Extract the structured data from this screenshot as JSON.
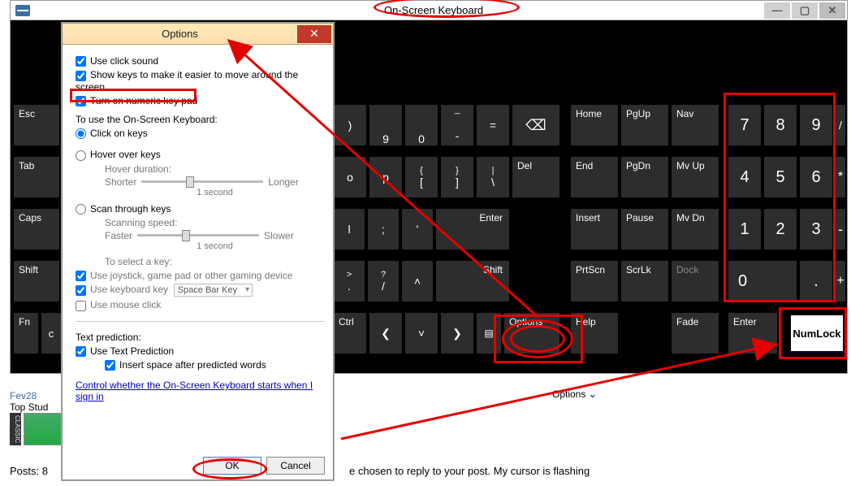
{
  "osk": {
    "title": "On-Screen Keyboard",
    "winbtn_min": "—",
    "winbtn_max": "▢",
    "winbtn_close": "✕",
    "keys": {
      "esc": "Esc",
      "tab": "Tab",
      "caps": "Caps",
      "shift": "Shift",
      "fn": "Fn",
      "c": "c",
      "ctrl": "Ctrl",
      "k9": "9",
      "k0": "0",
      "dash": "-",
      "equal": "=",
      "bksp": "⌫",
      "o": "o",
      "p": "p",
      "lbr": "[",
      "rbr": "]",
      "bslash": "\\",
      "l": "l",
      "semi": ";",
      "quote": "'",
      "enter_main": "Enter",
      "gt": ">",
      "slash": "?",
      "up": "˄",
      "shift_r": "Shift",
      "left": "❮",
      "dn": "˅",
      "right": "❯",
      "home": "Home",
      "pgup": "PgUp",
      "nav": "Nav",
      "del": "Del",
      "end": "End",
      "pgdn": "PgDn",
      "mvup": "Mv Up",
      "insert": "Insert",
      "pause": "Pause",
      "mvdn": "Mv Dn",
      "prtscn": "PrtScn",
      "scrlk": "ScrLk",
      "dock": "Dock",
      "options": "Options",
      "help": "Help",
      "fade": "Fade",
      "enter_np": "Enter",
      "np7": "7",
      "np8": "8",
      "np9": "9",
      "npdiv": "/",
      "np4": "4",
      "np5": "5",
      "np6": "6",
      "npmul": "*",
      "np1": "1",
      "np2": "2",
      "np3": "3",
      "npmin": "-",
      "np0": "0",
      "npdot": ".",
      "npplus": "+",
      "numlock": "NumLock",
      "sup_lbr": "{",
      "sup_rbr": "}",
      "sup_bslash": "|",
      "sup_dot": ".",
      "sup_slash": "/",
      "sup_dash": "_"
    },
    "lower_opts": "Options"
  },
  "dlg": {
    "title": "Options",
    "chk_clicksound": "Use click sound",
    "chk_showkeys": "Show keys to make it easier to move around the screen",
    "chk_numpad": "Turn on numeric key pad",
    "section_use": "To use the On-Screen Keyboard:",
    "rad_click": "Click on keys",
    "rad_hover": "Hover over keys",
    "hover_dur": "Hover duration:",
    "shorter": "Shorter",
    "longer": "Longer",
    "one_sec": "1 second",
    "rad_scan": "Scan through keys",
    "scan_speed": "Scanning speed:",
    "faster": "Faster",
    "slower": "Slower",
    "select_key": "To select a key:",
    "chk_joystick": "Use joystick, game pad or other gaming device",
    "chk_kbkey": "Use keyboard key",
    "kbkey_val": "Space Bar Key",
    "chk_mouse": "Use mouse click",
    "text_pred": "Text prediction:",
    "chk_textpred": "Use Text Prediction",
    "chk_insertspace": "Insert space after predicted words",
    "link": "Control whether the On-Screen Keyboard starts when I sign in",
    "ok": "OK",
    "cancel": "Cancel"
  },
  "page": {
    "fev": "Fev28",
    "topstud": "Top Stud",
    "classic": "CLASSIC",
    "posts": "Posts: 8",
    "reply": "e chosen to reply to your post. My cursor is flashing"
  }
}
